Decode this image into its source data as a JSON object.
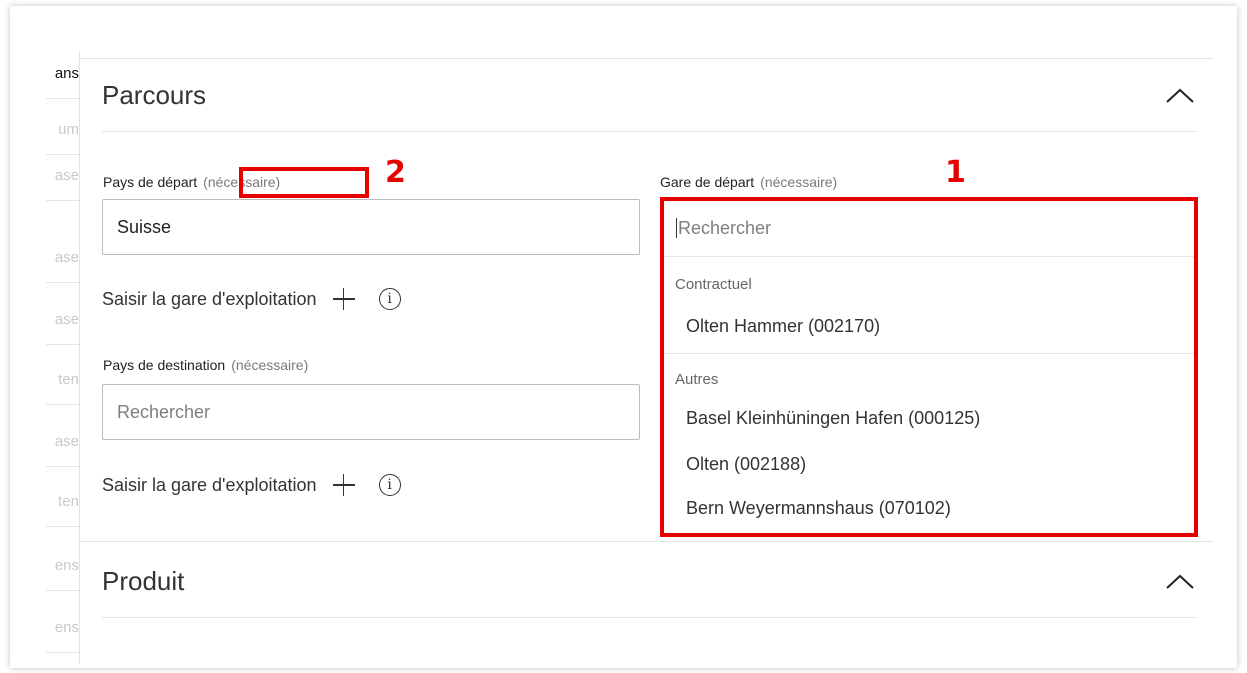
{
  "sidebar": {
    "items": [
      {
        "label": "ans",
        "active": true
      },
      {
        "label": "um",
        "active": false
      },
      {
        "label": "ase",
        "active": false
      },
      {
        "label": "ase",
        "active": false
      },
      {
        "label": "ase",
        "active": false
      },
      {
        "label": "ten",
        "active": false
      },
      {
        "label": "ase",
        "active": false
      },
      {
        "label": "ten",
        "active": false
      },
      {
        "label": "ens",
        "active": false
      },
      {
        "label": "ens",
        "active": false
      }
    ]
  },
  "parcours": {
    "title": "Parcours",
    "departure_country": {
      "label": "Pays de départ",
      "required": "(nécessaire)",
      "value": "Suisse"
    },
    "add_operating_station_1": "Saisir la gare d'exploitation",
    "destination_country": {
      "label": "Pays de destination",
      "required": "(nécessaire)",
      "placeholder": "Rechercher"
    },
    "add_operating_station_2": "Saisir la gare d'exploitation",
    "departure_station": {
      "label": "Gare de départ",
      "required": "(nécessaire)",
      "placeholder": "Rechercher",
      "groups": [
        {
          "name": "Contractuel",
          "options": [
            "Olten Hammer (002170)"
          ]
        },
        {
          "name": "Autres",
          "options": [
            "Basel Kleinhüningen Hafen (000125)",
            "Olten (002188)",
            "Bern Weyermannshaus (070102)"
          ]
        }
      ]
    }
  },
  "produit": {
    "title": "Produit"
  },
  "annotations": {
    "marker_1": "1",
    "marker_2": "2",
    "color": "#e60000"
  }
}
